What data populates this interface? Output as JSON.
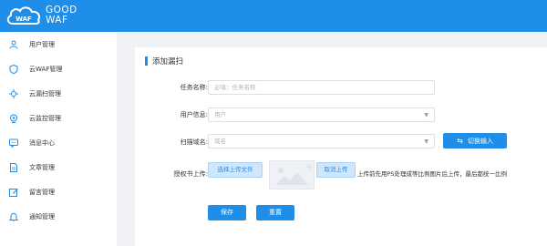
{
  "brand": {
    "line1": "GOOD",
    "line2": "WAF",
    "logo_text": "WAF",
    "color": "#1e8ee8"
  },
  "sidebar": {
    "items": [
      {
        "label": "用户管理",
        "icon": "user-icon"
      },
      {
        "label": "云WAF管理",
        "icon": "shield-icon"
      },
      {
        "label": "云漏扫管理",
        "icon": "scan-icon"
      },
      {
        "label": "云监控管理",
        "icon": "monitor-icon"
      },
      {
        "label": "消息中心",
        "icon": "message-icon"
      },
      {
        "label": "文章管理",
        "icon": "document-icon"
      },
      {
        "label": "留言管理",
        "icon": "edit-icon"
      },
      {
        "label": "通知管理",
        "icon": "bell-icon"
      }
    ]
  },
  "page": {
    "title": "添加漏扫"
  },
  "form": {
    "task_name": {
      "label": "任务名称:",
      "placeholder": "必填：任务名称"
    },
    "user_info": {
      "label": "用户信息:",
      "placeholder": "用户"
    },
    "scan_domain": {
      "label": "扫描域名:",
      "placeholder": "域名",
      "switch_label": "切换输入"
    },
    "upload": {
      "label": "授权书上传:",
      "select_label": "选择上传文件",
      "cancel_label": "取消上传",
      "hint": "上传前先用PS处理成等比例图片后上传，最后都统一比例"
    },
    "save_label": "保存",
    "reset_label": "重置"
  }
}
